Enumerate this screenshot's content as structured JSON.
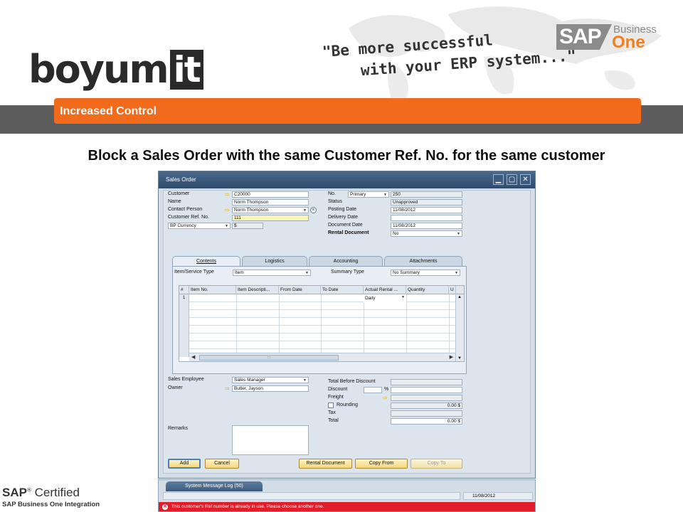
{
  "brand": {
    "logo_word": "boyum",
    "logo_box": "it",
    "tagline_line1": "\"Be more successful",
    "tagline_line2": "with your ERP system...\"",
    "sap_badge": "SAP",
    "sap_business": "Business",
    "sap_one": "One",
    "orange_color": "#f26a1b"
  },
  "section_label": "Increased Control",
  "slide_title": "Block a Sales Order with the same Customer Ref. No. for the same customer",
  "window": {
    "title": "Sales Order",
    "buttons": {
      "minimize": "▁",
      "maximize": "▢",
      "close": "✕"
    }
  },
  "header_left": {
    "customer_label": "Customer",
    "customer_value": "C20000",
    "name_label": "Name",
    "name_value": "Norm Thompson",
    "contact_label": "Contact Person",
    "contact_value": "Norm Thompson",
    "ref_label": "Customer Ref. No.",
    "ref_value": "111",
    "currency_label": "BP Currency",
    "currency_value": "$"
  },
  "header_right": {
    "no_label": "No.",
    "no_series": "Primary",
    "no_value": "250",
    "status_label": "Status",
    "status_value": "Unapproved",
    "posting_label": "Posting Date",
    "posting_value": "11/08/2012",
    "delivery_label": "Delivery Date",
    "delivery_value": "",
    "docdate_label": "Document Date",
    "docdate_value": "11/08/2012",
    "rental_label": "Rental Document",
    "rental_value": "No"
  },
  "tabs": [
    "Contents",
    "Logistics",
    "Accounting",
    "Attachments"
  ],
  "contents": {
    "type_label": "Item/Service Type",
    "type_value": "Item",
    "summary_label": "Summary Type",
    "summary_value": "No Summary",
    "columns": [
      "#",
      "Item No.",
      "Item Descripti...",
      "From Date",
      "To Date",
      "Actual Rental ...",
      "Quantity",
      "U"
    ],
    "first_row": {
      "num": "1",
      "rental": "Daily"
    },
    "thumb_grip": ":::"
  },
  "footer_left": {
    "employee_label": "Sales Employee",
    "employee_value": "Sales Manager",
    "owner_label": "Owner",
    "owner_value": "Butler, Jayson",
    "remarks_label": "Remarks"
  },
  "totals": {
    "before_discount_label": "Total Before Discount",
    "discount_label": "Discount",
    "discount_pct": "%",
    "freight_label": "Freight",
    "rounding_label": "Rounding",
    "rounding_value": "0.00 $",
    "tax_label": "Tax",
    "total_label": "Total",
    "total_value": "0.00 $"
  },
  "actions": {
    "add": "Add",
    "cancel": "Cancel",
    "rental_document": "Rental Document",
    "copy_from": "Copy From",
    "copy_to": "Copy To"
  },
  "status": {
    "log_tab": "System Message Log (50)",
    "date": "11/08/2012",
    "error_icon": "✕",
    "error_message": "This customer's Ref number is already in use. Please choose another one.",
    "error_color": "#e21d2b"
  },
  "certified": {
    "brand": "SAP",
    "reg": "®",
    "word": " Certified",
    "subtitle": "SAP Business One Integration"
  }
}
